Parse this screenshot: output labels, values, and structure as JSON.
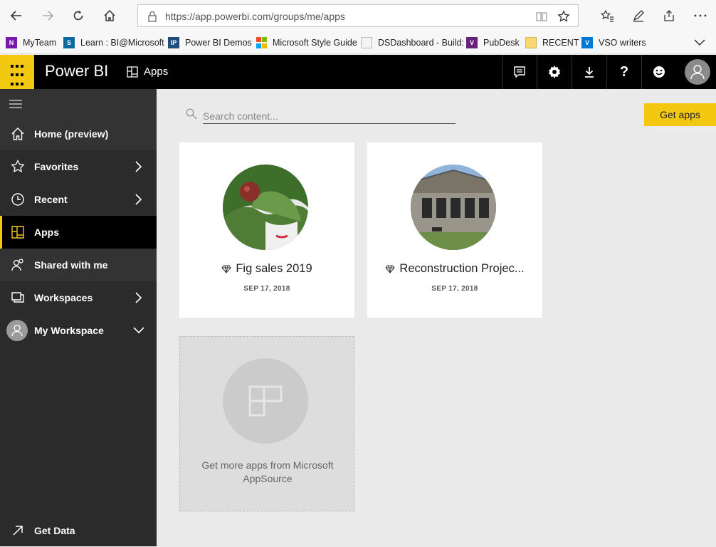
{
  "browser": {
    "url": "https://app.powerbi.com/groups/me/apps"
  },
  "favorites": [
    {
      "label": "MyTeam",
      "icon": "onenote-icon",
      "color": "#7719aa"
    },
    {
      "label": "Learn : BI@Microsoft",
      "icon": "sharepoint-icon",
      "color": "#0b6aa2"
    },
    {
      "label": "Power BI Demos",
      "icon": "ip-icon",
      "color": "#1e4e79"
    },
    {
      "label": "Microsoft Style Guide",
      "icon": "microsoft-logo-icon",
      "color": "#f25022"
    },
    {
      "label": "DSDashboard - Build:",
      "icon": "page-icon",
      "color": "#cccccc"
    },
    {
      "label": "PubDesk",
      "icon": "visual-studio-icon",
      "color": "#68217a"
    },
    {
      "label": "RECENT",
      "icon": "folder-icon",
      "color": "#f8d775"
    },
    {
      "label": "VSO writers",
      "icon": "vso-icon",
      "color": "#0078d4"
    }
  ],
  "header": {
    "brand": "Power BI",
    "crumb": "Apps",
    "accent": "#f2c811"
  },
  "sidebar": {
    "items": [
      {
        "label": "Home (preview)"
      },
      {
        "label": "Favorites"
      },
      {
        "label": "Recent"
      },
      {
        "label": "Apps"
      },
      {
        "label": "Shared with me"
      },
      {
        "label": "Workspaces"
      },
      {
        "label": "My Workspace"
      }
    ],
    "get_data": "Get Data"
  },
  "search": {
    "placeholder": "Search content..."
  },
  "get_apps_label": "Get apps",
  "apps": [
    {
      "title": "Fig sales 2019",
      "date": "SEP 17, 2018"
    },
    {
      "title": "Reconstruction Projec...",
      "date": "SEP 17, 2018"
    }
  ],
  "more_apps": {
    "text": "Get more apps from Microsoft AppSource"
  }
}
